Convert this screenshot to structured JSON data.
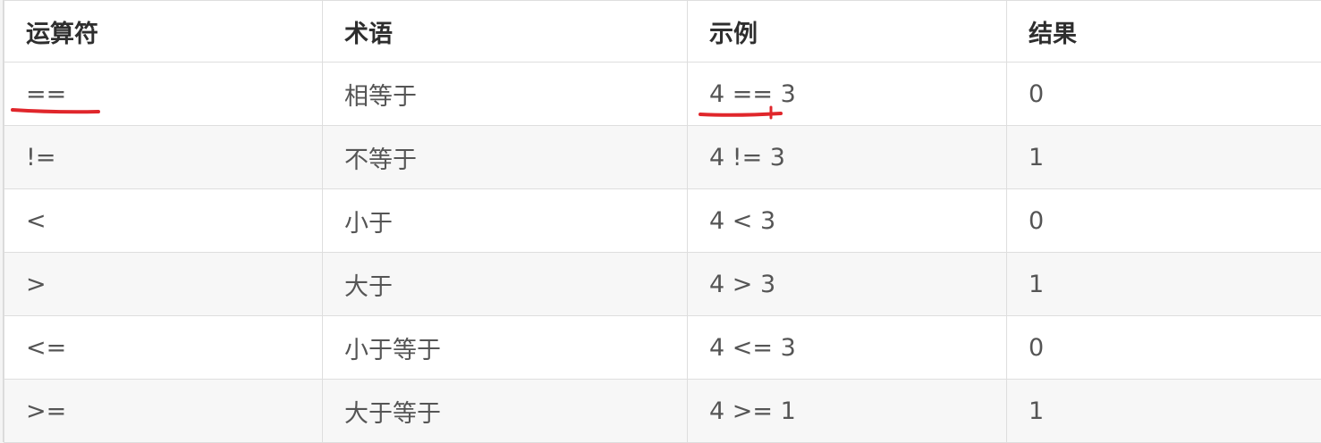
{
  "table": {
    "headers": [
      "运算符",
      "术语",
      "示例",
      "结果"
    ],
    "rows": [
      {
        "operator": "==",
        "term": "相等于",
        "example": "4 == 3",
        "result": "0"
      },
      {
        "operator": "!=",
        "term": "不等于",
        "example": "4 != 3",
        "result": "1"
      },
      {
        "operator": "<",
        "term": "小于",
        "example": "4 < 3",
        "result": "0"
      },
      {
        "operator": ">",
        "term": "大于",
        "example": "4 > 3",
        "result": "1"
      },
      {
        "operator": "<=",
        "term": "小于等于",
        "example": "4 <= 3",
        "result": "0"
      },
      {
        "operator": ">=",
        "term": "大于等于",
        "example": "4 >= 1",
        "result": "1"
      }
    ]
  },
  "annotations": {
    "color": "#e0262b"
  }
}
